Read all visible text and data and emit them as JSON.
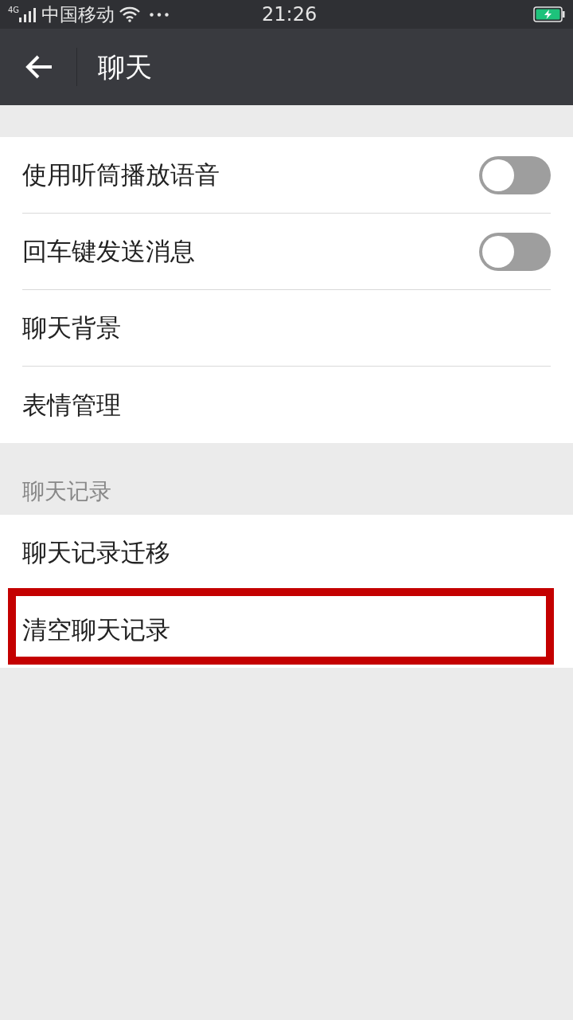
{
  "status_bar": {
    "network": "4G",
    "carrier": "中国移动",
    "time": "21:26"
  },
  "header": {
    "title": "聊天"
  },
  "sections": [
    {
      "items": [
        {
          "kind": "toggle",
          "label": "使用听筒播放语音",
          "on": false,
          "highlighted": false
        },
        {
          "kind": "toggle",
          "label": "回车键发送消息",
          "on": false,
          "highlighted": false
        },
        {
          "kind": "link",
          "label": "聊天背景",
          "highlighted": false
        },
        {
          "kind": "link",
          "label": "表情管理",
          "highlighted": false
        }
      ]
    },
    {
      "title": "聊天记录",
      "items": [
        {
          "kind": "link",
          "label": "聊天记录迁移",
          "highlighted": false
        },
        {
          "kind": "link",
          "label": "清空聊天记录",
          "highlighted": true
        }
      ]
    }
  ]
}
